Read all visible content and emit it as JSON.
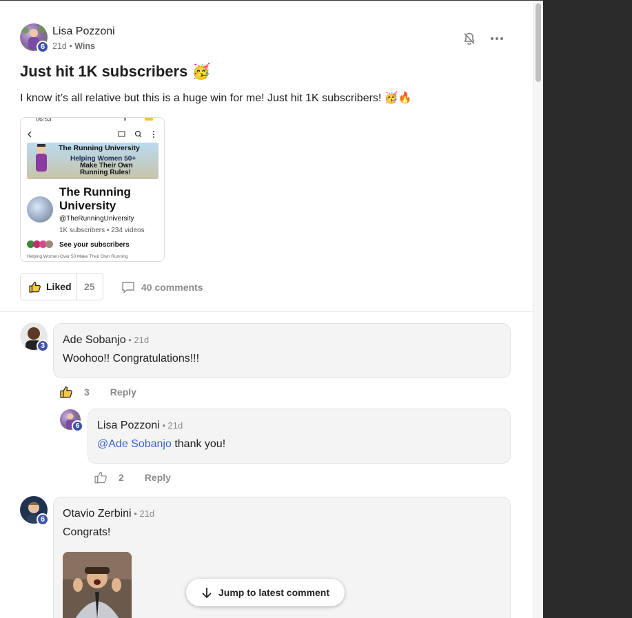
{
  "post": {
    "author": "Lisa Pozzoni",
    "author_level": "6",
    "age": "21d",
    "separator": " • ",
    "category": "Wins",
    "title": "Just hit 1K subscribers 🥳",
    "body": "I know it’s all relative but this is a huge win for me! Just hit 1K subscribers! 🥳🔥",
    "liked_label": "Liked",
    "like_count": "25",
    "comments_label": "40 comments",
    "bell_icon": "bell-off-icon",
    "more_icon": "more-horizontal-icon"
  },
  "screenshot": {
    "time": "06:53",
    "banner_line1": "The Running University",
    "banner_line2": "Helping Women 50+",
    "banner_line3": "Make Their Own",
    "banner_line4": "Running Rules!",
    "channel_name_1": "The Running",
    "channel_name_2": "University",
    "handle": "@TheRunningUniversity",
    "stats": "1K subscribers • 234 videos",
    "see_subscribers": "See your subscribers",
    "tagline": "Helping Women Over 50 Make Their Own Running"
  },
  "comments": [
    {
      "author": "Ade Sobanjo",
      "level": "3",
      "age": " • 21d",
      "text": "Woohoo!! Congratulations!!!",
      "likes": "3",
      "reply_label": "Reply",
      "liked": true
    },
    {
      "author": "Lisa Pozzoni",
      "level": "6",
      "age": " • 21d",
      "mention": "@Ade Sobanjo",
      "text": " thank you!",
      "likes": "2",
      "reply_label": "Reply",
      "liked": false
    },
    {
      "author": "Otavio Zerbini",
      "level": "6",
      "age": " • 21d",
      "text": "Congrats!"
    }
  ],
  "jump_label": "Jump to latest comment",
  "colors": {
    "level_badge": "#3f51a5",
    "mention": "#3c63c9",
    "liked_thumb_fill": "#f6c945"
  }
}
